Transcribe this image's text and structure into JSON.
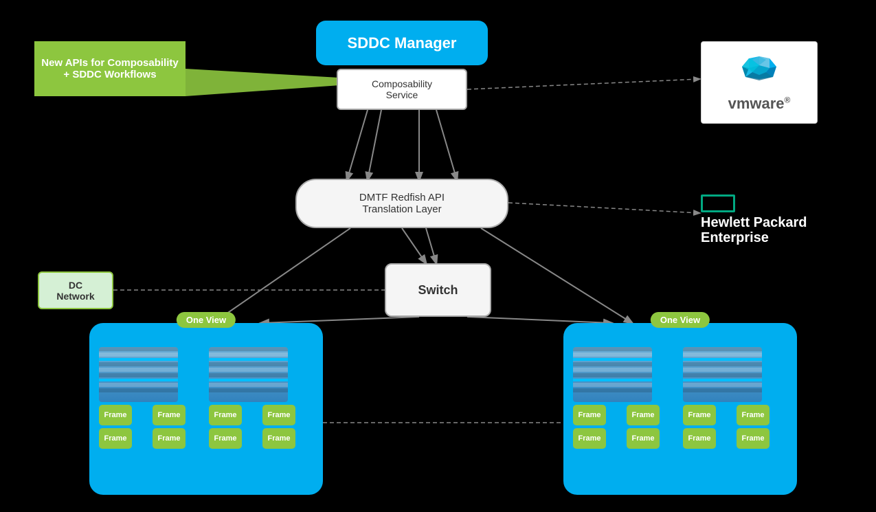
{
  "background_color": "#000000",
  "sddc_manager": {
    "label": "SDDC Manager"
  },
  "composability_service": {
    "label": "Composability\nService"
  },
  "new_apis": {
    "label": "New APIs for\nComposability +\nSDDC Workflows"
  },
  "dmtf_redfish": {
    "label": "DMTF Redfish API\nTranslation Layer"
  },
  "switch_box": {
    "label": "Switch"
  },
  "dc_network": {
    "label": "DC\nNetwork"
  },
  "one_view_label": "One View",
  "frame_labels": [
    "Frame",
    "Frame",
    "Frame",
    "Frame"
  ],
  "vmware_logo": {
    "text": "vmware",
    "registered": "®"
  },
  "hpe_logo": {
    "line1": "Hewlett Packard",
    "line2": "Enterprise"
  },
  "colors": {
    "cyan": "#00AEEF",
    "green": "#8DC63F",
    "white": "#ffffff",
    "gray_border": "#aaaaaa",
    "black": "#000000",
    "dark_gray": "#333333",
    "light_bg": "#f5f5f5",
    "light_green_bg": "#d5f0d5",
    "hpe_green": "#01A982"
  }
}
